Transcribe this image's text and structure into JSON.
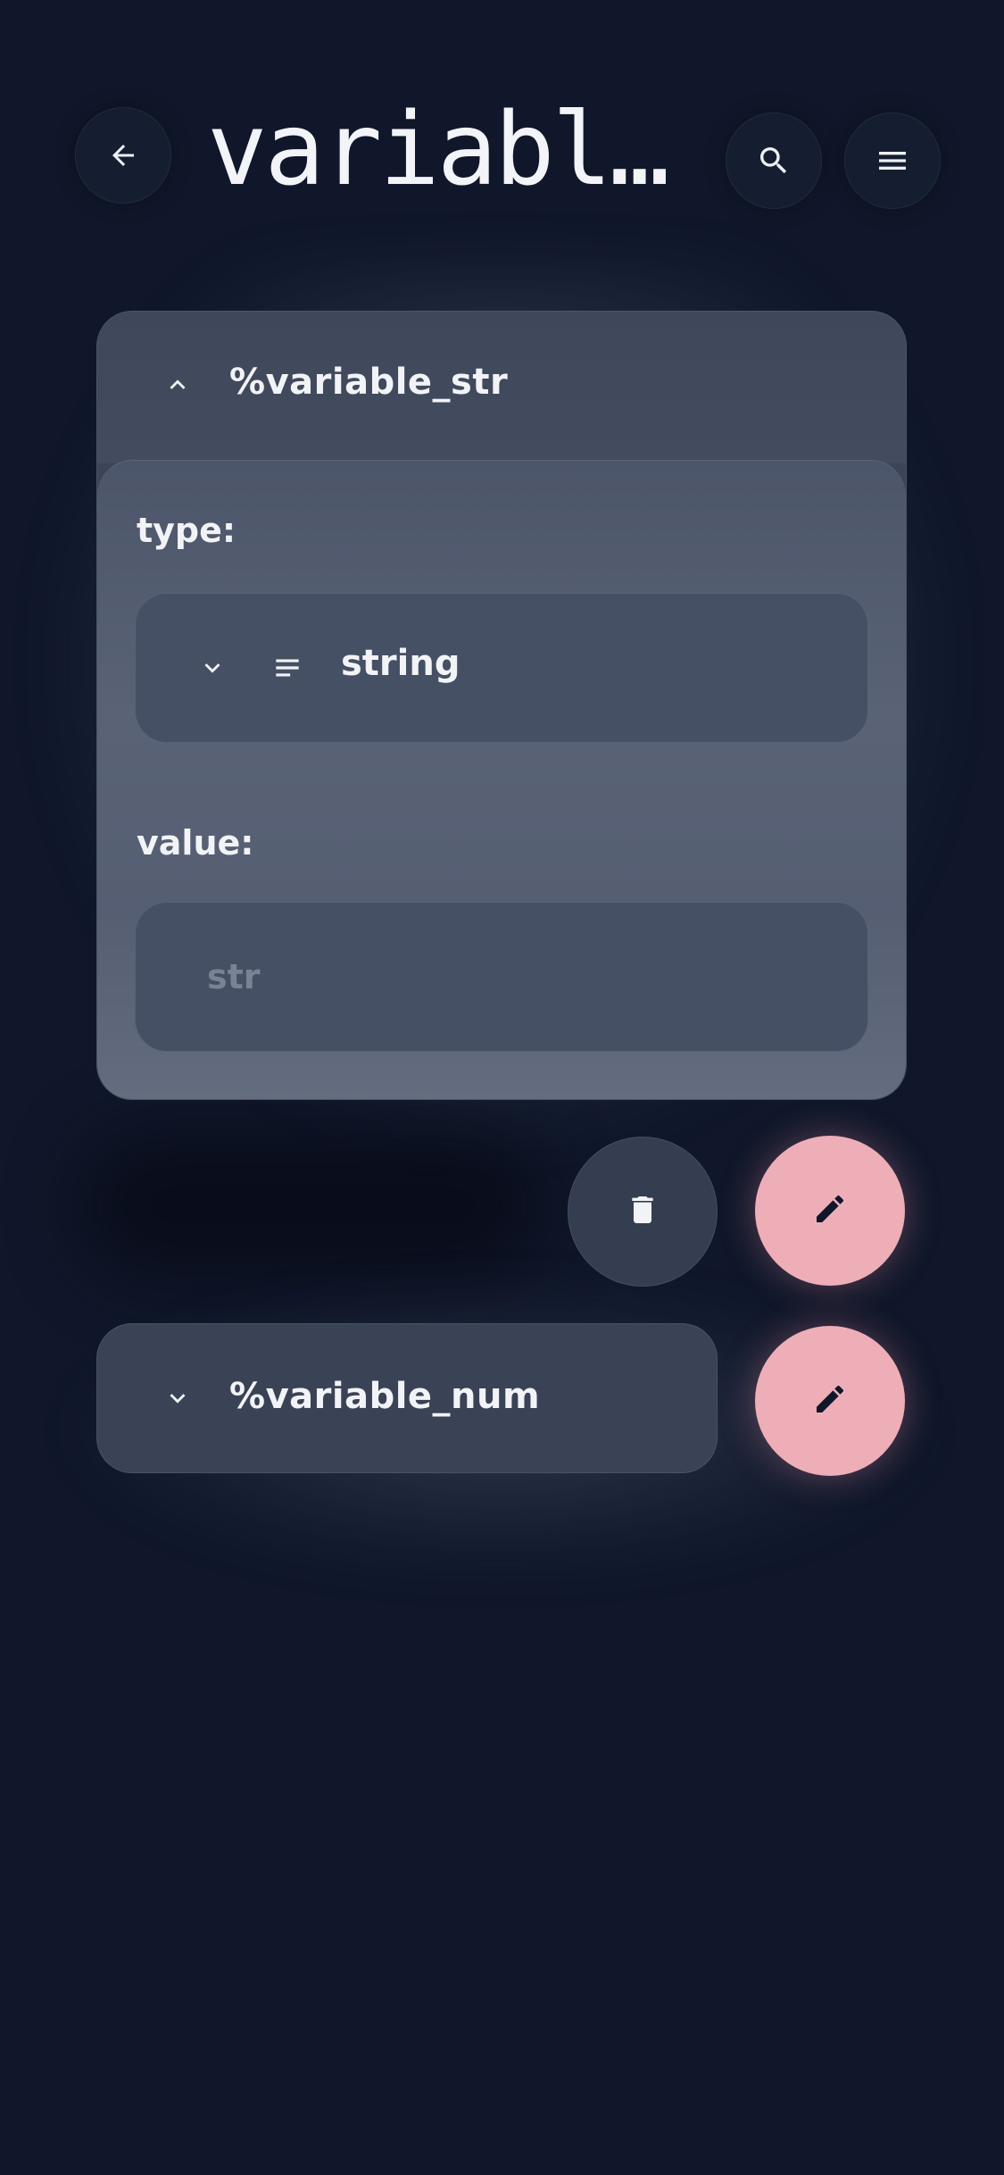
{
  "header": {
    "title": "variabl…",
    "back_icon": "arrow-left-icon",
    "search_icon": "search-icon",
    "menu_icon": "menu-icon"
  },
  "variables": [
    {
      "name": "%variable_str",
      "expanded": true,
      "toggle_icon": "chevron-up-icon",
      "type_label": "type:",
      "type": {
        "value": "string",
        "dropdown_icon": "chevron-down-icon",
        "type_icon": "text-lines-icon"
      },
      "value_label": "value:",
      "value_placeholder": "str",
      "actions": {
        "delete_icon": "trash-icon",
        "edit_icon": "pencil-icon"
      }
    },
    {
      "name": "%variable_num",
      "expanded": false,
      "toggle_icon": "chevron-down-icon",
      "actions": {
        "edit_icon": "pencil-icon"
      }
    }
  ],
  "colors": {
    "background": "#10172a",
    "card": "#3c4558",
    "card_body": "#555e72",
    "accent_pink": "#eeaeb8",
    "text": "#f2f3f7",
    "placeholder": "#7a8296"
  }
}
